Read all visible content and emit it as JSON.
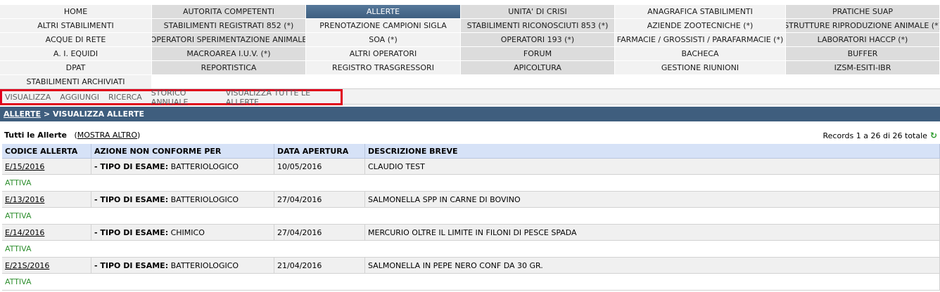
{
  "nav": {
    "rows": [
      [
        "HOME",
        "AUTORITA COMPETENTI",
        "ALLERTE",
        "UNITA' DI CRISI",
        "ANAGRAFICA STABILIMENTI",
        "PRATICHE SUAP"
      ],
      [
        "ALTRI STABILIMENTI",
        "STABILIMENTI REGISTRATI 852 (*)",
        "PRENOTAZIONE CAMPIONI SIGLA",
        "STABILIMENTI RICONOSCIUTI 853 (*)",
        "AZIENDE ZOOTECNICHE (*)",
        "STRUTTURE RIPRODUZIONE ANIMALE (*)"
      ],
      [
        "ACQUE DI RETE",
        "OPERATORI SPERIMENTAZIONE ANIMALE",
        "SOA (*)",
        "OPERATORI 193 (*)",
        "FARMACIE / GROSSISTI / PARAFARMACIE (*)",
        "LABORATORI HACCP (*)"
      ],
      [
        "A. I. EQUIDI",
        "MACROAREA I.U.V. (*)",
        "ALTRI OPERATORI",
        "FORUM",
        "BACHECA",
        "BUFFER"
      ],
      [
        "DPAT",
        "REPORTISTICA",
        "REGISTRO TRASGRESSORI",
        "APICOLTURA",
        "GESTIONE RIUNIONI",
        "IZSM-ESITI-IBR"
      ],
      [
        "STABILIMENTI ARCHIVIATI"
      ]
    ],
    "active": "ALLERTE"
  },
  "subnav": [
    "VISUALIZZA",
    "AGGIUNGI",
    "RICERCA",
    "STORICO ANNUALE",
    "VISUALIZZA TUTTE LE ALLERTE"
  ],
  "breadcrumb": {
    "link": "ALLERTE",
    "separator": " > ",
    "current": "VISUALIZZA ALLERTE"
  },
  "list": {
    "title": "Tutti le Allerte",
    "more_label": "MOSTRA ALTRO",
    "records_text": "Records 1 a 26 di 26 totale",
    "refresh_icon": "refresh-icon"
  },
  "table": {
    "headers": [
      "CODICE ALLERTA",
      "AZIONE NON CONFORME PER",
      "DATA APERTURA",
      "DESCRIZIONE BREVE"
    ],
    "action_prefix": "- TIPO DI ESAME:",
    "rows": [
      {
        "code": "E/15/2016",
        "exam": "BATTERIOLOGICO",
        "date": "10/05/2016",
        "desc": "CLAUDIO TEST",
        "status": "ATTIVA"
      },
      {
        "code": "E/13/2016",
        "exam": "BATTERIOLOGICO",
        "date": "27/04/2016",
        "desc": "SALMONELLA SPP IN CARNE DI BOVINO",
        "status": "ATTIVA"
      },
      {
        "code": "E/14/2016",
        "exam": "CHIMICO",
        "date": "27/04/2016",
        "desc": "MERCURIO OLTRE IL LIMITE IN FILONI DI PESCE SPADA",
        "status": "ATTIVA"
      },
      {
        "code": "E/21S/2016",
        "exam": "BATTERIOLOGICO",
        "date": "21/04/2016",
        "desc": "SALMONELLA IN PEPE NERO CONF DA 30 GR.",
        "status": "ATTIVA"
      }
    ]
  },
  "colors": {
    "nav_active": "#4a6b8c",
    "breadcrumb_bg": "#3f5e7e",
    "header_bg": "#d6e2f7",
    "status_green": "#2f8f2f",
    "highlight_red": "#e0001b"
  }
}
